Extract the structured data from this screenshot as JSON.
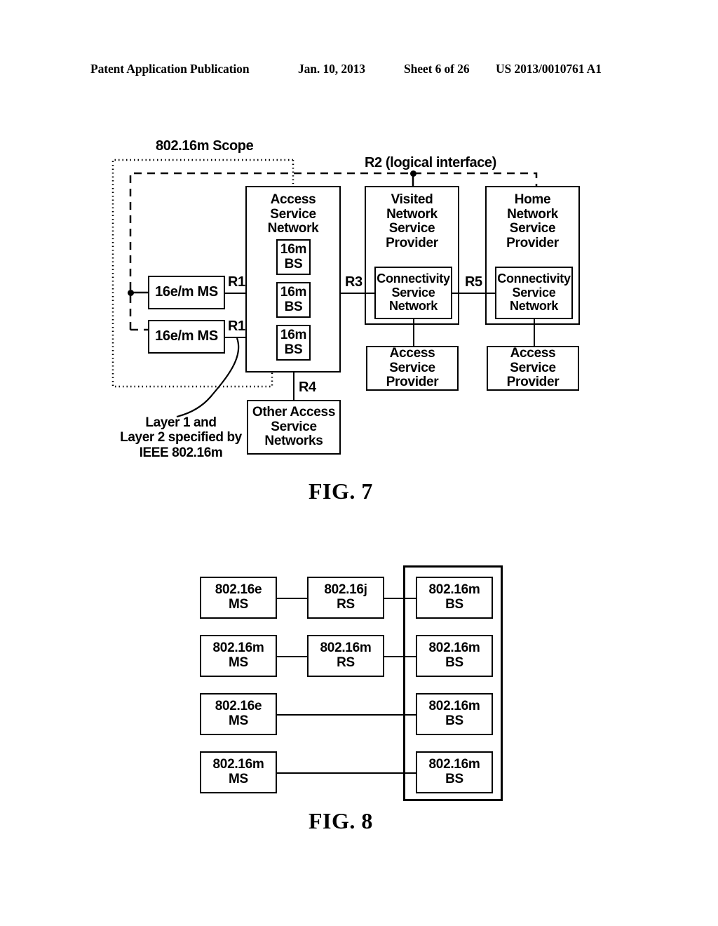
{
  "header": {
    "publication": "Patent Application Publication",
    "date": "Jan. 10, 2013",
    "sheet": "Sheet 6 of 26",
    "number": "US 2013/0010761 A1"
  },
  "figures": [
    {
      "caption": "FIG. 7",
      "scope_label": "802.16m Scope",
      "r2_label": "R2 (logical interface)",
      "interfaces": {
        "r1_top": "R1",
        "r1_bottom": "R1",
        "r3": "R3",
        "r4": "R4",
        "r5": "R5"
      },
      "note": "Layer 1 and\nLayer 2 specified by\nIEEE 802.16m",
      "ms_top": "16e/m MS",
      "ms_bottom": "16e/m MS",
      "access_service_network": {
        "title": "Access Service\nNetwork",
        "base_stations": [
          "16m\nBS",
          "16m\nBS",
          "16m\nBS"
        ]
      },
      "other_asn": "Other Access\nService\nNetworks",
      "visited": {
        "title": "Visited\nNetwork\nService\nProvider",
        "csn": "Connectivity\nService\nNetwork",
        "asp": "Access\nService\nProvider"
      },
      "home": {
        "title": "Home\nNetwork\nService\nProvider",
        "csn": "Connectivity\nService\nNetwork",
        "asp": "Access\nService\nProvider"
      }
    },
    {
      "caption": "FIG. 8",
      "rows": [
        {
          "ms": "802.16e\nMS",
          "rs": "802.16j\nRS",
          "bs": "802.16m\nBS",
          "has_rs": true
        },
        {
          "ms": "802.16m\nMS",
          "rs": "802.16m\nRS",
          "bs": "802.16m\nBS",
          "has_rs": true
        },
        {
          "ms": "802.16e\nMS",
          "rs": "",
          "bs": "802.16m\nBS",
          "has_rs": false
        },
        {
          "ms": "802.16m\nMS",
          "rs": "",
          "bs": "802.16m\nBS",
          "has_rs": false
        }
      ]
    }
  ]
}
